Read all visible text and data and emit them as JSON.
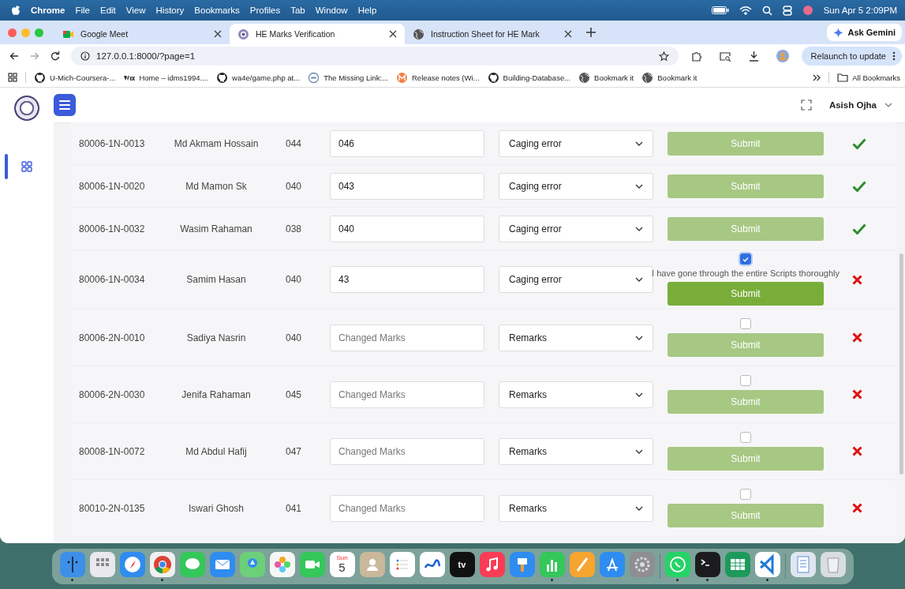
{
  "menu_bar": {
    "items": [
      "Chrome",
      "File",
      "Edit",
      "View",
      "History",
      "Bookmarks",
      "Profiles",
      "Tab",
      "Window",
      "Help"
    ],
    "clock": "Sun Apr 5  2:09PM"
  },
  "tabs": [
    {
      "title": "Google Meet",
      "selected": false
    },
    {
      "title": "HE Marks Verification",
      "selected": true
    },
    {
      "title": "Instruction Sheet for HE Mark",
      "selected": false
    }
  ],
  "ask_gemini": "Ask Gemini",
  "address": "127.0.0.1:8000/?page=1",
  "relaunch": "Relaunch to update",
  "bookmarks": [
    "U-Mich-Coursera-...",
    "Home – idms1994....",
    "wa4e/game.php at...",
    "The Missing Link:...",
    "Release notes (Wi...",
    "Building-Database...",
    "Bookmark it",
    "Bookmark it"
  ],
  "all_bookmarks": "All Bookmarks",
  "user": "Asish Ojha",
  "rows": [
    {
      "roll": "80006-1N-0013",
      "name": "Md Akmam Hossain",
      "marks": "044",
      "changed_marks": "046",
      "remark": "Caging error",
      "submit": "Submit",
      "submitted": true
    },
    {
      "roll": "80006-1N-0020",
      "name": "Md Mamon Sk",
      "marks": "040",
      "changed_marks": "043",
      "remark": "Caging error",
      "submit": "Submit",
      "submitted": true
    },
    {
      "roll": "80006-1N-0032",
      "name": "Wasim Rahaman",
      "marks": "038",
      "changed_marks": "040",
      "remark": "Caging error",
      "submit": "Submit",
      "submitted": true
    },
    {
      "roll": "80006-1N-0034",
      "name": "Samim Hasan",
      "marks": "040",
      "changed_marks": "43",
      "remark": "Caging error",
      "submit": "Submit",
      "submitted": false,
      "checked": true,
      "declaration": "I have gone through the entire Scripts thoroughly"
    },
    {
      "roll": "80006-2N-0010",
      "name": "Sadiya Nasrin",
      "marks": "040",
      "placeholder": "Changed Marks",
      "remark_placeholder": "Remarks",
      "submit": "Submit",
      "submitted": false,
      "checked": false
    },
    {
      "roll": "80006-2N-0030",
      "name": "Jenifa Rahaman",
      "marks": "045",
      "placeholder": "Changed Marks",
      "remark_placeholder": "Remarks",
      "submit": "Submit",
      "submitted": false,
      "checked": false
    },
    {
      "roll": "80008-1N-0072",
      "name": "Md Abdul Hafij",
      "marks": "047",
      "placeholder": "Changed Marks",
      "remark_placeholder": "Remarks",
      "submit": "Submit",
      "submitted": false,
      "checked": false
    },
    {
      "roll": "80010-2N-0135",
      "name": "Iswari Ghosh",
      "marks": "041",
      "placeholder": "Changed Marks",
      "remark_placeholder": "Remarks",
      "submit": "Submit",
      "submitted": false,
      "checked": false
    }
  ],
  "dock": [
    {
      "apps": [
        {
          "kind": "finder",
          "running": true
        },
        {
          "kind": "launchpad",
          "running": false
        },
        {
          "kind": "safari",
          "running": false
        },
        {
          "kind": "chrome",
          "running": true
        },
        {
          "kind": "messages",
          "running": false
        },
        {
          "kind": "mail",
          "running": false
        },
        {
          "kind": "maps",
          "running": false
        },
        {
          "kind": "photos",
          "running": false
        },
        {
          "kind": "facetime",
          "running": false
        },
        {
          "kind": "calendar",
          "running": false,
          "day": "Sun",
          "date": "5"
        },
        {
          "kind": "contacts",
          "running": false
        },
        {
          "kind": "reminders",
          "running": false
        },
        {
          "kind": "freeform",
          "running": false
        },
        {
          "kind": "tv",
          "running": false,
          "label": "tv"
        },
        {
          "kind": "music",
          "running": false
        },
        {
          "kind": "keynote",
          "running": false
        },
        {
          "kind": "numbers",
          "running": true
        },
        {
          "kind": "pages",
          "running": false
        },
        {
          "kind": "appstore",
          "running": false
        },
        {
          "kind": "settings",
          "running": false
        }
      ]
    },
    {
      "apps": [
        {
          "kind": "whatsapp",
          "running": true
        },
        {
          "kind": "terminal",
          "running": true
        },
        {
          "kind": "excel",
          "running": false
        },
        {
          "kind": "vscode",
          "running": true
        }
      ]
    },
    {
      "apps": [
        {
          "kind": "files",
          "running": false
        },
        {
          "kind": "trash",
          "running": false
        }
      ]
    }
  ]
}
